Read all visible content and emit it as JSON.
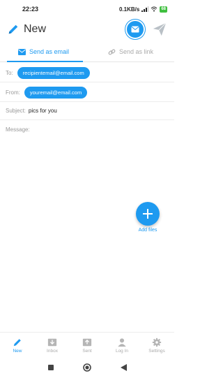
{
  "status": {
    "time": "22:23",
    "speed": "0.1KB/s",
    "battery": "68"
  },
  "header": {
    "title": "New"
  },
  "tabs": [
    {
      "label": "Send as email"
    },
    {
      "label": "Send as link"
    }
  ],
  "fields": {
    "to_label": "To:",
    "to_value": "recipientemail@email.com",
    "from_label": "From:",
    "from_value": "youremail@email.com",
    "subject_label": "Subject:",
    "subject_value": "pics for you",
    "message_label": "Message:"
  },
  "fab": {
    "label": "Add files"
  },
  "nav": [
    {
      "label": "New",
      "icon": "pencil-icon"
    },
    {
      "label": "Inbox",
      "icon": "inbox-icon"
    },
    {
      "label": "Sent",
      "icon": "sent-icon"
    },
    {
      "label": "Log In",
      "icon": "user-icon"
    },
    {
      "label": "Settings",
      "icon": "gear-icon"
    }
  ],
  "colors": {
    "accent": "#1e9af0",
    "muted": "#aaaaaa"
  }
}
